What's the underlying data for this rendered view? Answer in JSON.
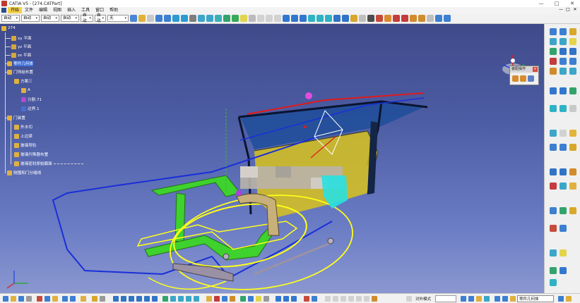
{
  "window": {
    "title": "CATIA V5 - [274.CATPart]",
    "buttons": [
      "—",
      "□",
      "✕"
    ]
  },
  "menubar": {
    "items": [
      "开始",
      "文件",
      "编辑",
      "视图",
      "插入",
      "工具",
      "窗口",
      "帮助"
    ],
    "mdi_buttons": [
      "—",
      "□",
      "✕"
    ]
  },
  "toolbar": {
    "selects": [
      "自动",
      "自动",
      "自动",
      "自动",
      "自动",
      "自动",
      "无"
    ]
  },
  "tree": {
    "root": "274",
    "planes": [
      "xy 平面",
      "yz 平面",
      "zx 平面"
    ],
    "body": "零件几何体",
    "set1": "门饰结布置",
    "scheme": "方案三",
    "sub_a": "A",
    "split": "分割.71",
    "boundary": "边界.1",
    "set2": "门装置",
    "items": [
      "外水切",
      "上边梁",
      "玻璃导轨",
      "玻璃升降器布置",
      "玻璃密封原始截面"
    ],
    "set3": "侧围和门分缝线"
  },
  "assembly_panel": {
    "title": "装配操作",
    "close": "x"
  },
  "statusbar": {
    "label": "对外模式",
    "input_value": "零件几何体"
  },
  "colors": {
    "background_top": "#3f4a8a",
    "background_bottom": "#8a97d0",
    "green_part": "#3fd12d",
    "yellow_part": "#ffff1a",
    "blue_curve": "#1a2fd8",
    "red_edge": "#e11a1a"
  }
}
